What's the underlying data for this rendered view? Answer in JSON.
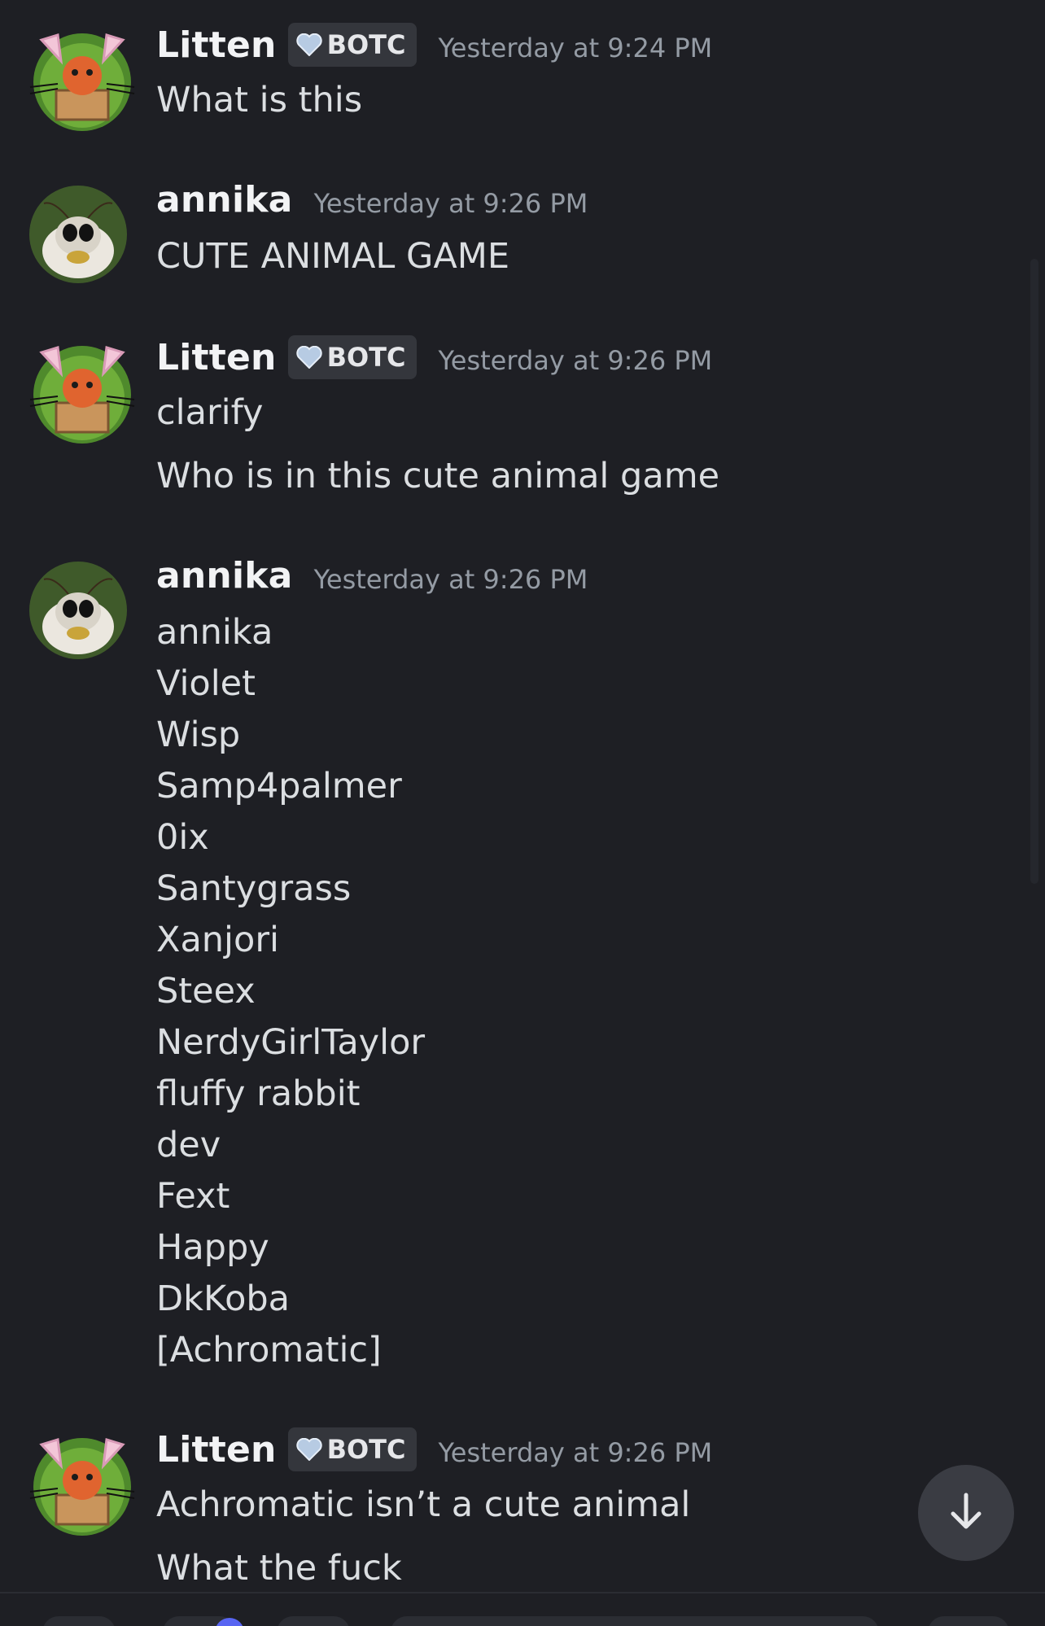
{
  "messages": [
    {
      "author": "Litten",
      "tag": "BOTC",
      "timestamp": "Yesterday at 9:24 PM",
      "lines": [
        "What is this"
      ]
    },
    {
      "author": "annika",
      "tag": "",
      "timestamp": "Yesterday at 9:26 PM",
      "lines": [
        "CUTE ANIMAL GAME"
      ]
    },
    {
      "author": "Litten",
      "tag": "BOTC",
      "timestamp": "Yesterday at 9:26 PM",
      "lines": [
        "clarify",
        "Who is in this cute animal game"
      ]
    },
    {
      "author": "annika",
      "tag": "",
      "timestamp": "Yesterday at 9:26 PM",
      "lines": [
        "annika",
        "Violet",
        "Wisp",
        "Samp4palmer",
        "0ix",
        "Santygrass",
        "Xanjori",
        "Steex",
        "NerdyGirlTaylor",
        "fluffy rabbit",
        "dev",
        "Fext",
        "Happy",
        "DkKoba",
        "[Achromatic]"
      ]
    },
    {
      "author": "Litten",
      "tag": "BOTC",
      "timestamp": "Yesterday at 9:26 PM",
      "lines": [
        "Achromatic isn’t a cute animal",
        "What the fuck"
      ]
    }
  ],
  "icons": {
    "tag_icon": "heart-icon",
    "jump_button_icon": "arrow-down-icon"
  },
  "colors": {
    "background": "#1e1f24",
    "username": "#f2f3f5",
    "timestamp": "#949ba4",
    "text": "#dbdee1",
    "tag_bg": "#34363c",
    "accent": "#5865f2"
  }
}
